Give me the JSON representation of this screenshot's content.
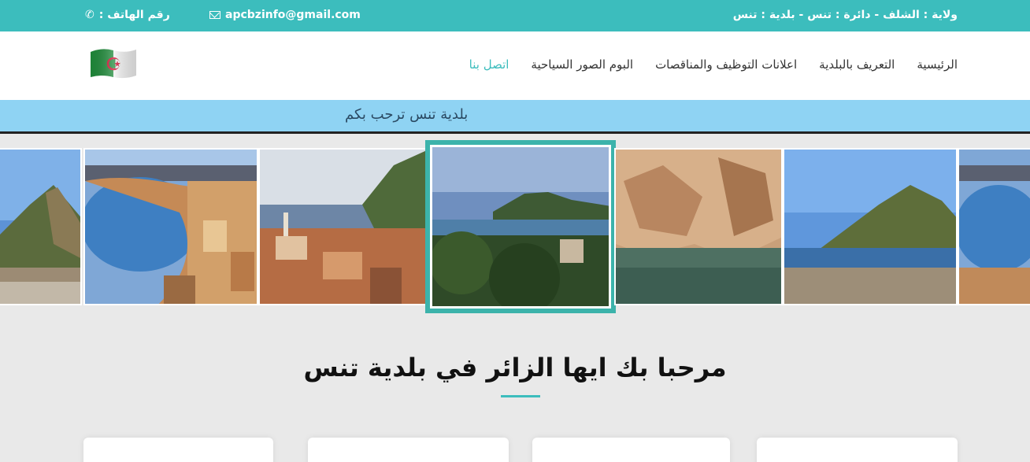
{
  "topbar": {
    "location": "ولاية : الشلف - دائرة : تنس - بلدية : تنس",
    "email": "apcbzinfo@gmail.com",
    "phone_label": ": رقم الهاتف",
    "icons": {
      "email": "mail-icon",
      "phone": "phone-icon"
    },
    "bg_color": "#3cbdbd"
  },
  "nav": {
    "items": [
      {
        "label": "الرئيسية",
        "active": false
      },
      {
        "label": "التعريف بالبلدية",
        "active": false
      },
      {
        "label": "اعلانات التوظيف والمناقصات",
        "active": false
      },
      {
        "label": "البوم الصور السياحية",
        "active": false
      },
      {
        "label": "اتصل بنا",
        "active": true
      }
    ],
    "accent_color": "#3cbdbd"
  },
  "strip": {
    "text": "بلدية تنس ترحب بكم"
  },
  "gallery": {
    "photos": [
      {
        "name": "mountain-bay-photo-left"
      },
      {
        "name": "coastal-town-beach-photo"
      },
      {
        "name": "harbor-city-photo"
      },
      {
        "name": "bay-view-photo-selected"
      },
      {
        "name": "sea-cave-photo"
      },
      {
        "name": "mountain-bay-photo-right"
      },
      {
        "name": "coastal-town-photo-edge"
      }
    ]
  },
  "main": {
    "heading": "مرحبا بك ايها الزائر في بلدية تنس"
  }
}
